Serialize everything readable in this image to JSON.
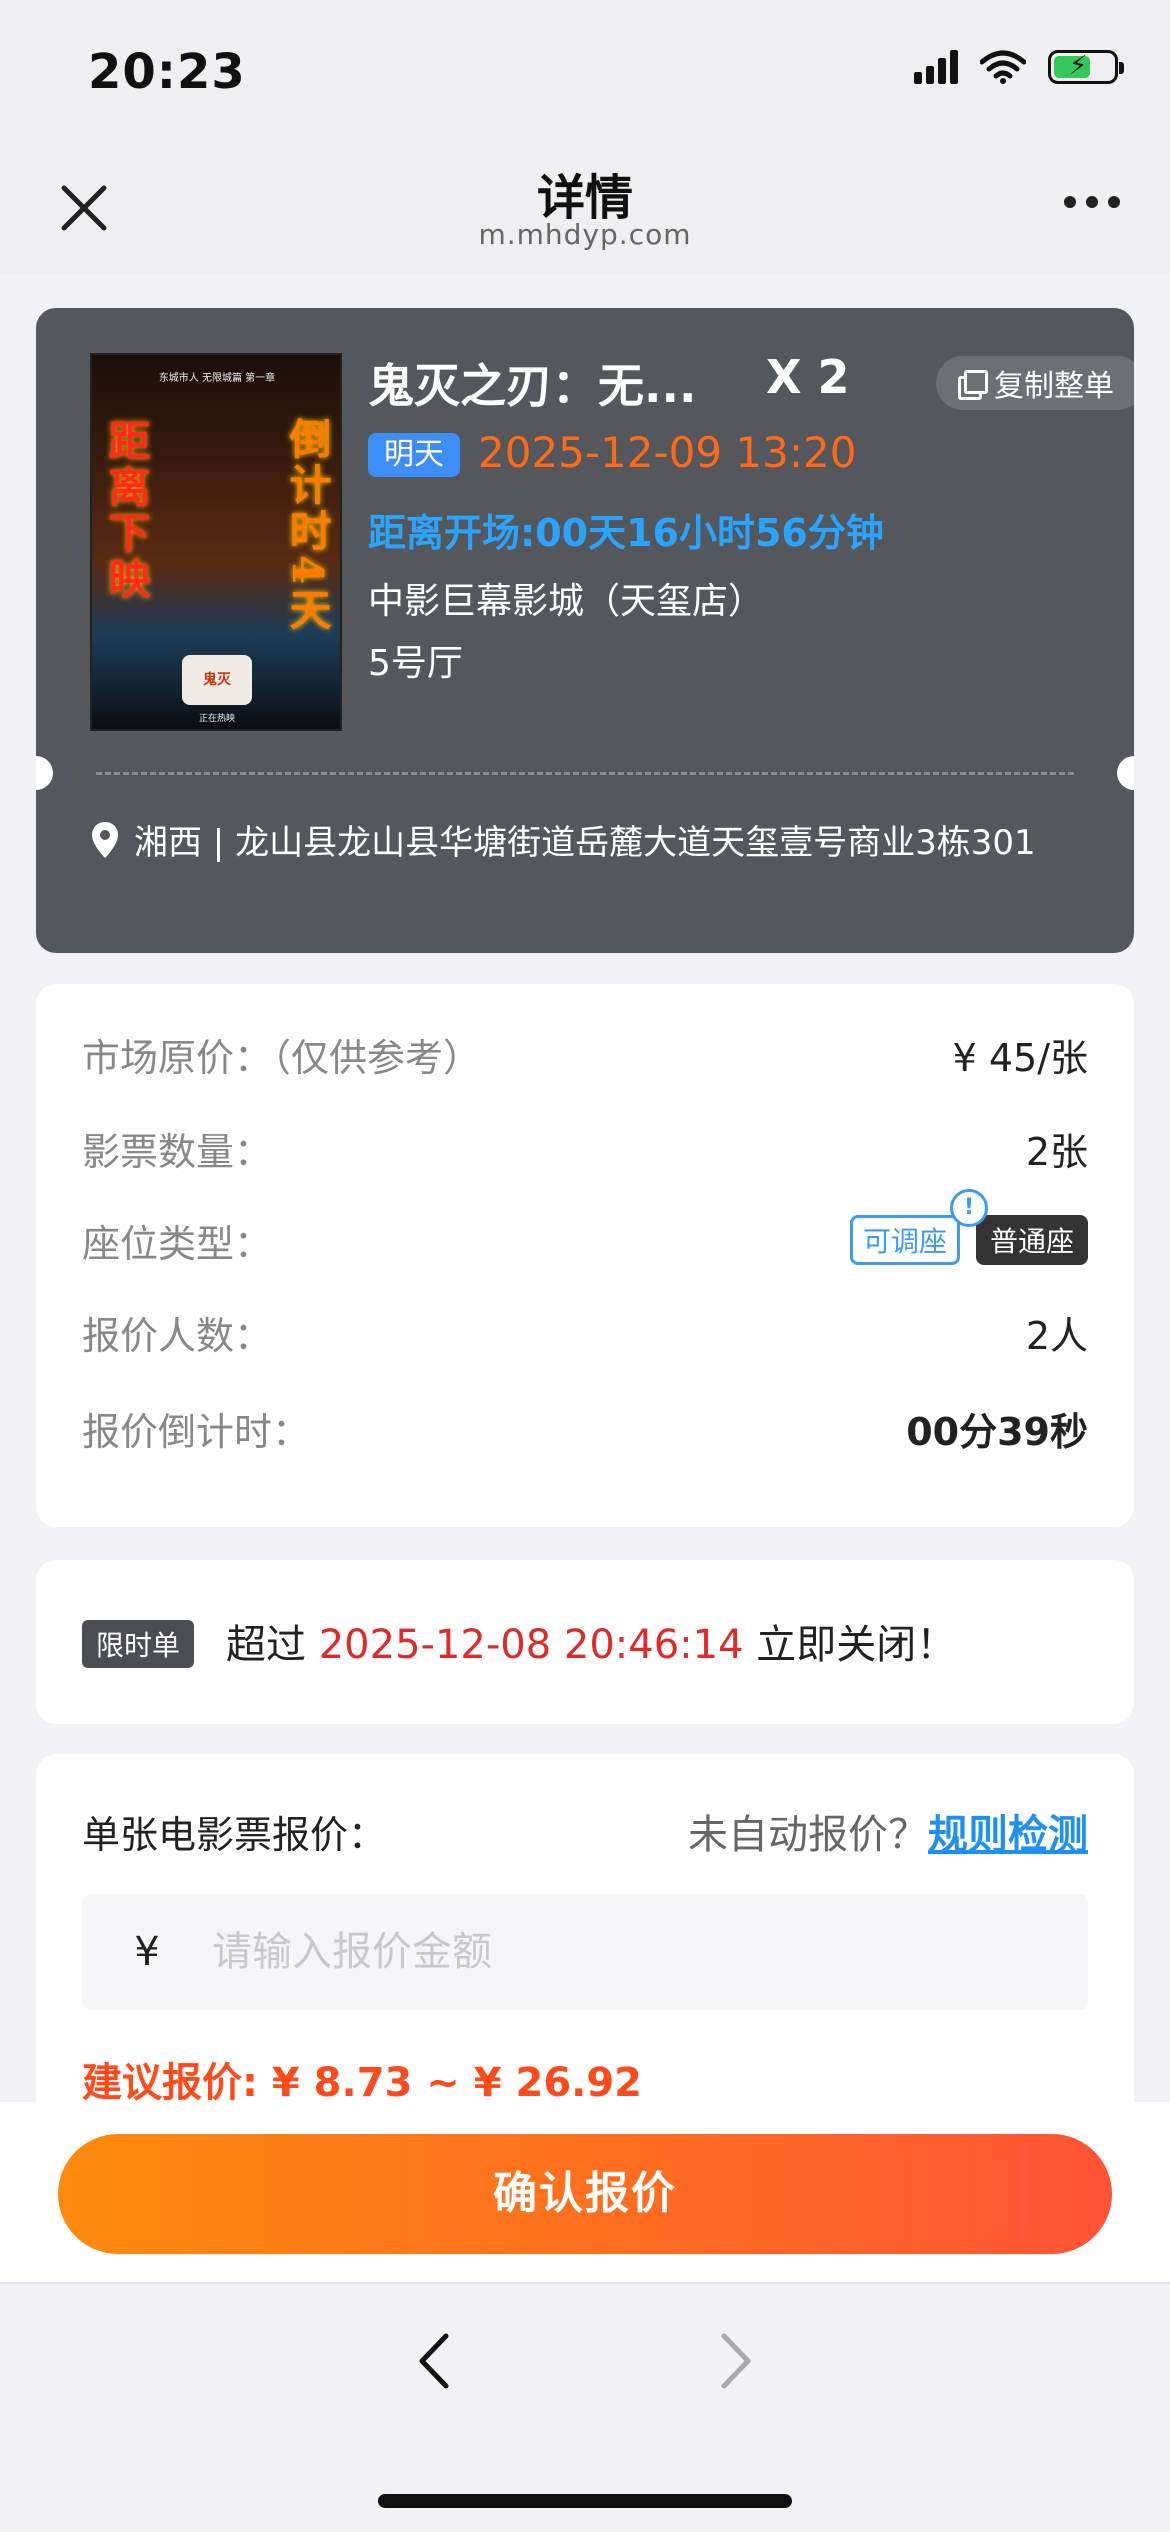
{
  "status": {
    "time": "20:23"
  },
  "nav": {
    "title": "详情",
    "url": "m.mhdyp.com"
  },
  "ticket": {
    "poster": {
      "top_text": "东城市人 无限城篇 第一章",
      "left_vertical": "距离下映",
      "right_vertical": "倒计时4天",
      "logo_text": "鬼灭",
      "bottom_text": "正在热映"
    },
    "title": "鬼灭之刃：无...",
    "quantity": "X 2",
    "copy_label": "复制整单",
    "day_label": "明天",
    "show_time": "2025-12-09 13:20",
    "countdown": "距离开场:00天16小时56分钟",
    "cinema": "中影巨幕影城（天玺店）",
    "hall": "5号厅",
    "address": "湘西 | 龙山县龙山县华塘街道岳麓大道天玺壹号商业3栋301"
  },
  "info": {
    "market_price_label": "市场原价：（仅供参考）",
    "market_price_value": "¥ 45/张",
    "ticket_count_label": "影票数量：",
    "ticket_count_value": "2张",
    "seat_type_label": "座位类型：",
    "seat_tag_adjustable": "可调座",
    "seat_tag_info": "!",
    "seat_tag_normal": "普通座",
    "bidders_label": "报价人数：",
    "bidders_value": "2人",
    "bid_countdown_label": "报价倒计时：",
    "bid_countdown_value": "00分39秒"
  },
  "limited": {
    "tag": "限时单",
    "prefix": "超过",
    "time": "2025-12-08 20:46:14",
    "suffix": "立即关闭！"
  },
  "quote": {
    "label": "单张电影票报价：",
    "auto_question": "未自动报价？",
    "rule_link": "规则检测",
    "currency": "¥",
    "placeholder": "请输入报价金额",
    "suggestion": "建议报价: ¥ 8.73 ~ ¥ 26.92"
  },
  "confirm": {
    "label": "确认报价"
  },
  "colors": {
    "accent_orange": "#ff6a22",
    "link_blue": "#1f8ff0",
    "ticket_bg": "#54575c"
  }
}
